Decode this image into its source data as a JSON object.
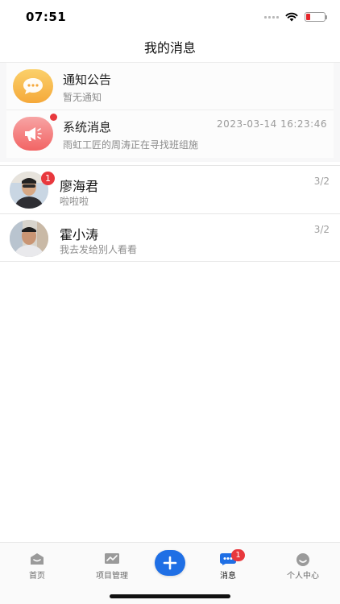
{
  "status_bar": {
    "time": "07:51",
    "battery_color": "#e5262b"
  },
  "header": {
    "title": "我的消息"
  },
  "notices": [
    {
      "icon": "chat-bubble-icon",
      "title": "通知公告",
      "subtitle": "暂无通知",
      "time": "",
      "unread": false,
      "color": "#f5a93a"
    },
    {
      "icon": "megaphone-icon",
      "title": "系统消息",
      "subtitle": "雨虹工匠的周涛正在寻找班组施",
      "time": "2023-03-14 16:23:46",
      "unread": true,
      "color": "#f26464"
    }
  ],
  "conversations": [
    {
      "name": "廖海君",
      "message": "啦啦啦",
      "date": "3/2",
      "unread_count": "1"
    },
    {
      "name": "霍小涛",
      "message": "我去发给别人看看",
      "date": "3/2",
      "unread_count": ""
    }
  ],
  "tab_bar": {
    "items": [
      {
        "label": "首页",
        "icon": "home-icon"
      },
      {
        "label": "项目管理",
        "icon": "chart-icon"
      },
      {
        "label": "",
        "icon": "plus-icon"
      },
      {
        "label": "消息",
        "icon": "message-icon",
        "badge": "1"
      },
      {
        "label": "个人中心",
        "icon": "profile-icon"
      }
    ],
    "active": "消息",
    "accent": "#1f6fe5"
  }
}
